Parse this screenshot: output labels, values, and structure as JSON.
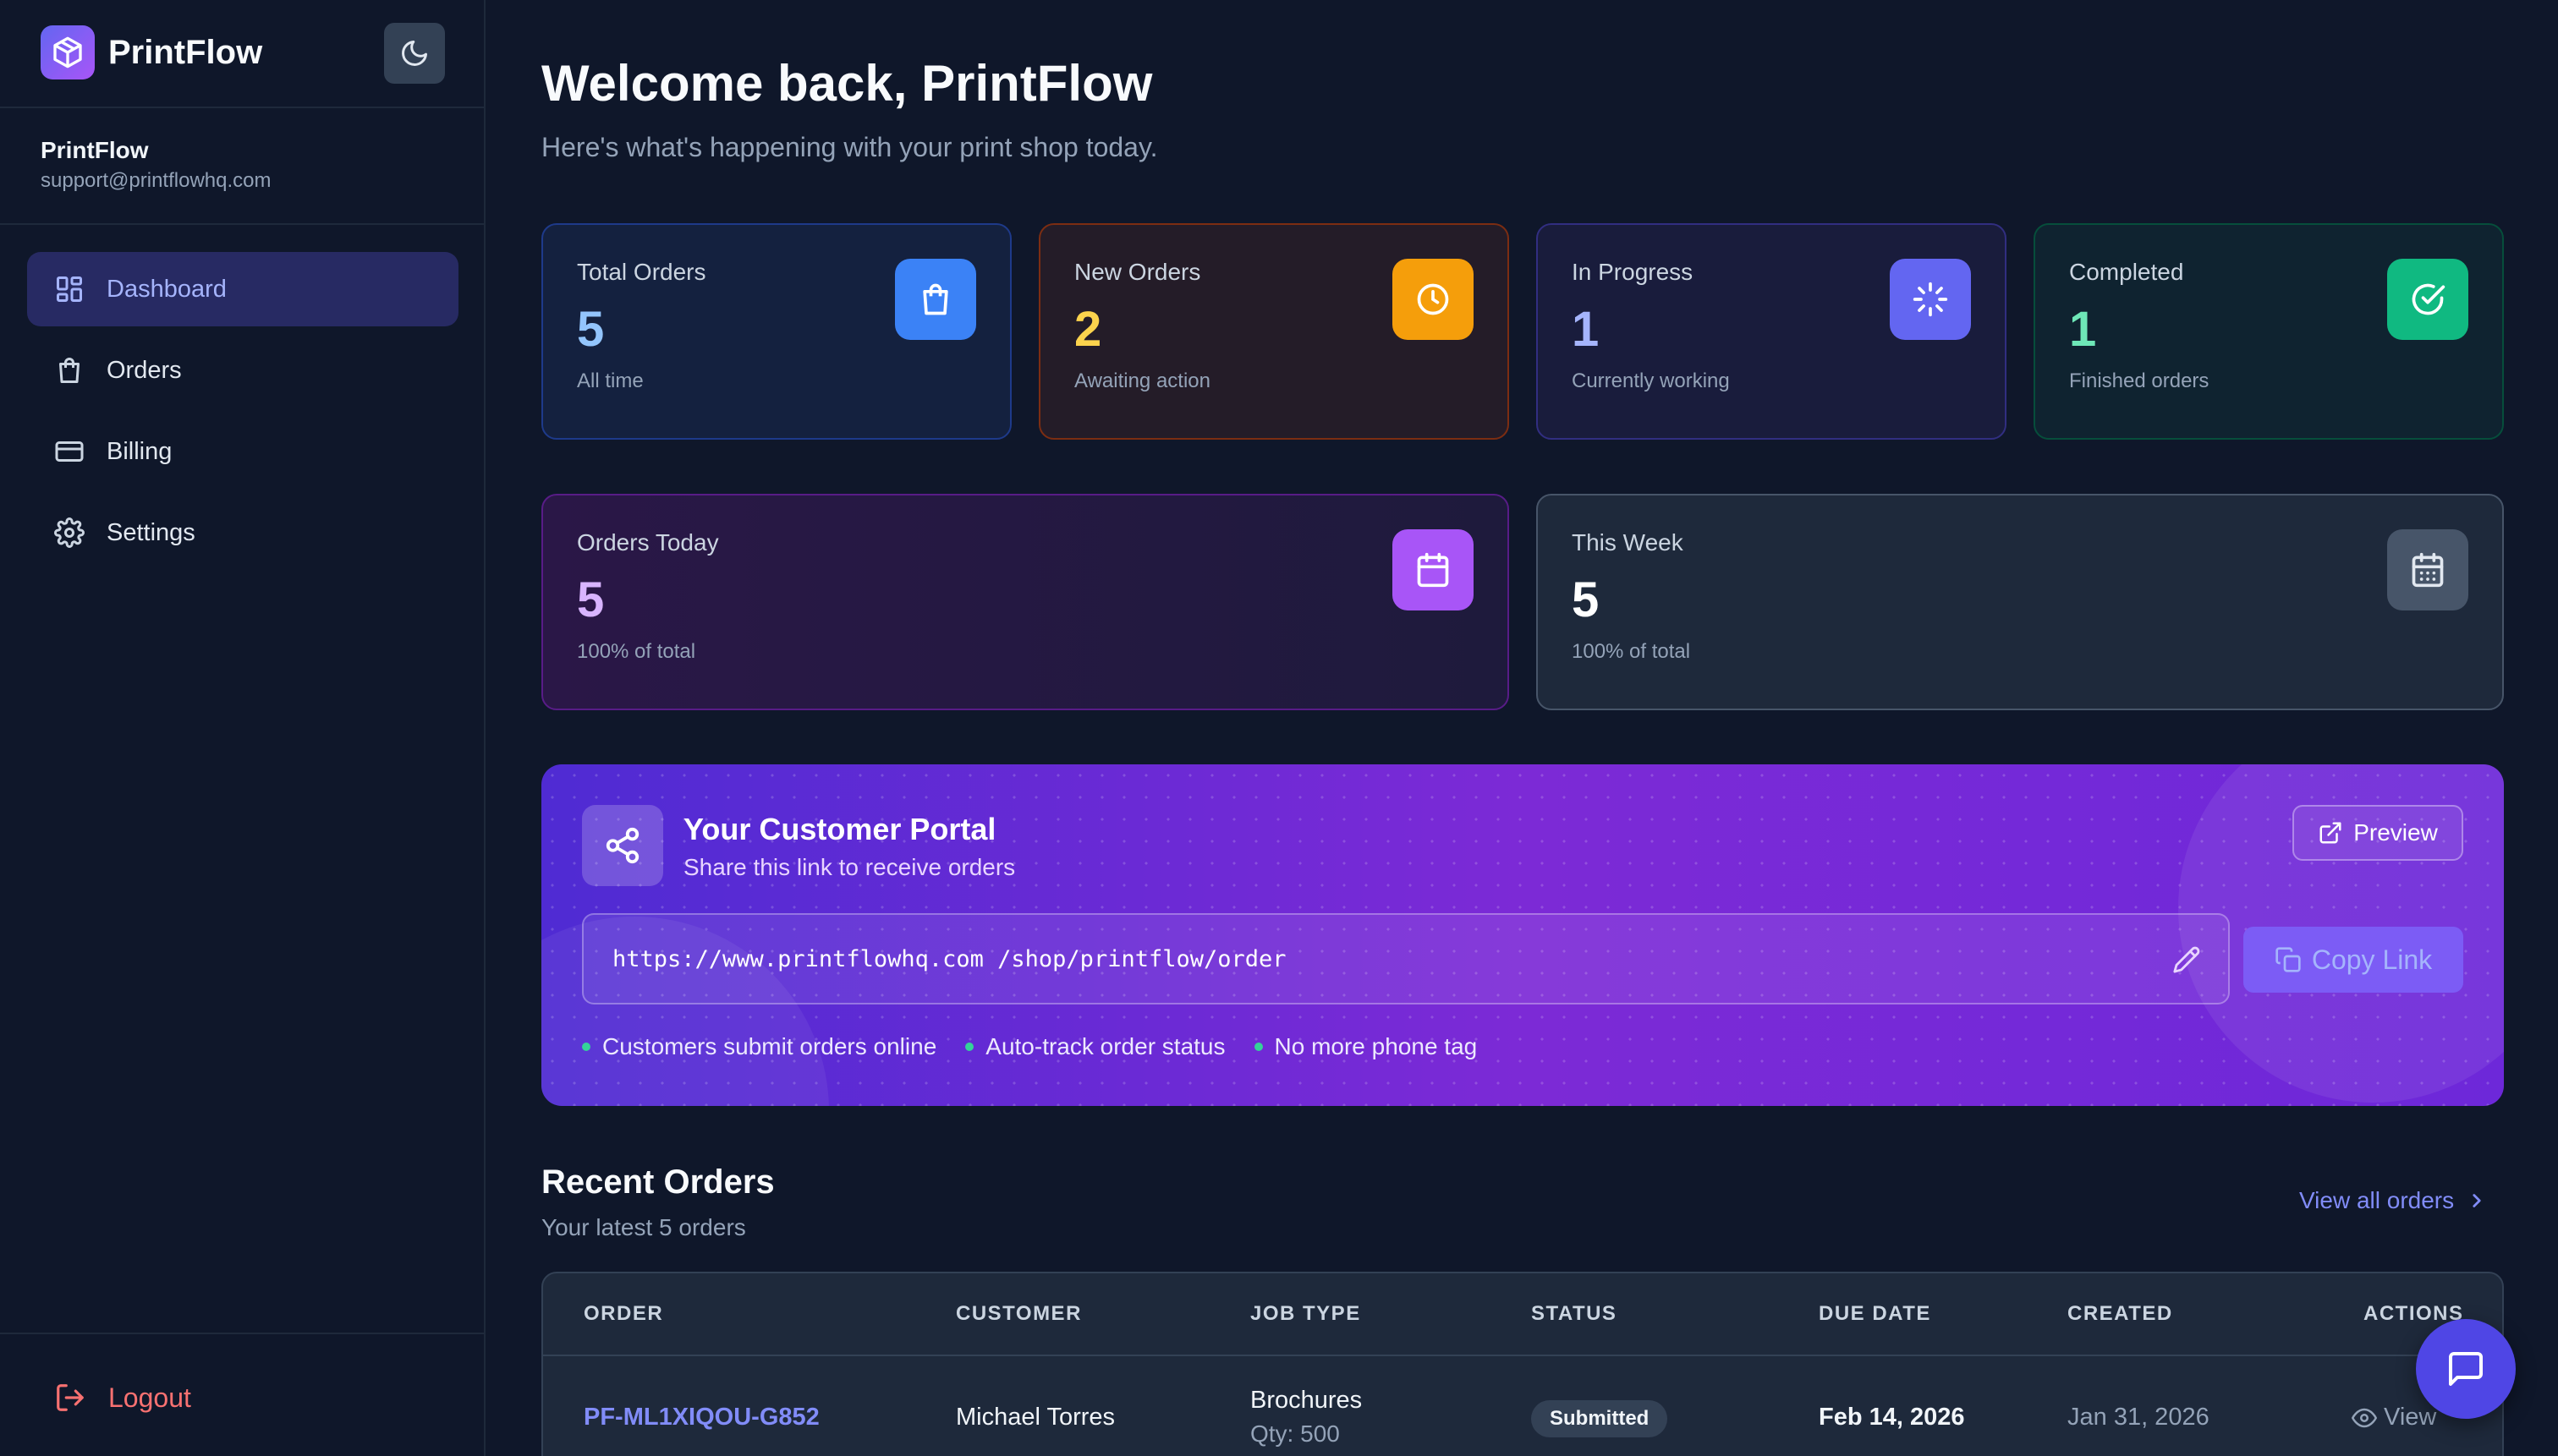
{
  "app": {
    "name": "PrintFlow"
  },
  "user": {
    "name": "PrintFlow",
    "email": "support@printflowhq.com"
  },
  "nav": {
    "items": [
      {
        "label": "Dashboard",
        "icon": "dashboard-icon",
        "active": true
      },
      {
        "label": "Orders",
        "icon": "shopping-bag-icon",
        "active": false
      },
      {
        "label": "Billing",
        "icon": "credit-card-icon",
        "active": false
      },
      {
        "label": "Settings",
        "icon": "gear-icon",
        "active": false
      }
    ],
    "logout": "Logout"
  },
  "header": {
    "title": "Welcome back, PrintFlow",
    "subtitle": "Here's what's happening with your print shop today."
  },
  "stats": [
    {
      "label": "Total Orders",
      "value": "5",
      "sub": "All time",
      "icon": "shopping-bag-icon",
      "color": "#3b82f6",
      "value_color": "#93c5fd"
    },
    {
      "label": "New Orders",
      "value": "2",
      "sub": "Awaiting action",
      "icon": "clock-icon",
      "color": "#f59e0b",
      "value_color": "#fcd34d"
    },
    {
      "label": "In Progress",
      "value": "1",
      "sub": "Currently working",
      "icon": "loader-icon",
      "color": "#6366f1",
      "value_color": "#a5b4fc"
    },
    {
      "label": "Completed",
      "value": "1",
      "sub": "Finished orders",
      "icon": "check-circle-icon",
      "color": "#10b981",
      "value_color": "#6ee7b7"
    },
    {
      "label": "Orders Today",
      "value": "5",
      "sub": "100% of total",
      "icon": "calendar-icon",
      "color": "#a855f7",
      "value_color": "#d8b4fe"
    },
    {
      "label": "This Week",
      "value": "5",
      "sub": "100% of total",
      "icon": "calendar-grid-icon",
      "color": "#475569",
      "value_color": "#ffffff"
    }
  ],
  "portal": {
    "title": "Your Customer Portal",
    "subtitle": "Share this link to receive orders",
    "preview_label": "Preview",
    "url": "https://www.printflowhq.com /shop/printflow/order",
    "copy_label": "Copy Link",
    "features": [
      "Customers submit orders online",
      "Auto-track order status",
      "No more phone tag"
    ]
  },
  "recent_orders": {
    "title": "Recent Orders",
    "subtitle": "Your latest 5 orders",
    "view_all": "View all orders",
    "columns": [
      "ORDER",
      "CUSTOMER",
      "JOB TYPE",
      "STATUS",
      "DUE DATE",
      "CREATED",
      "ACTIONS"
    ],
    "rows": [
      {
        "order": "PF-ML1XIQOU-G852",
        "customer": "Michael Torres",
        "job_type": "Brochures",
        "qty": "Qty: 500",
        "status": "Submitted",
        "due": "Feb 14, 2026",
        "created": "Jan 31, 2026",
        "action": "View"
      }
    ]
  }
}
